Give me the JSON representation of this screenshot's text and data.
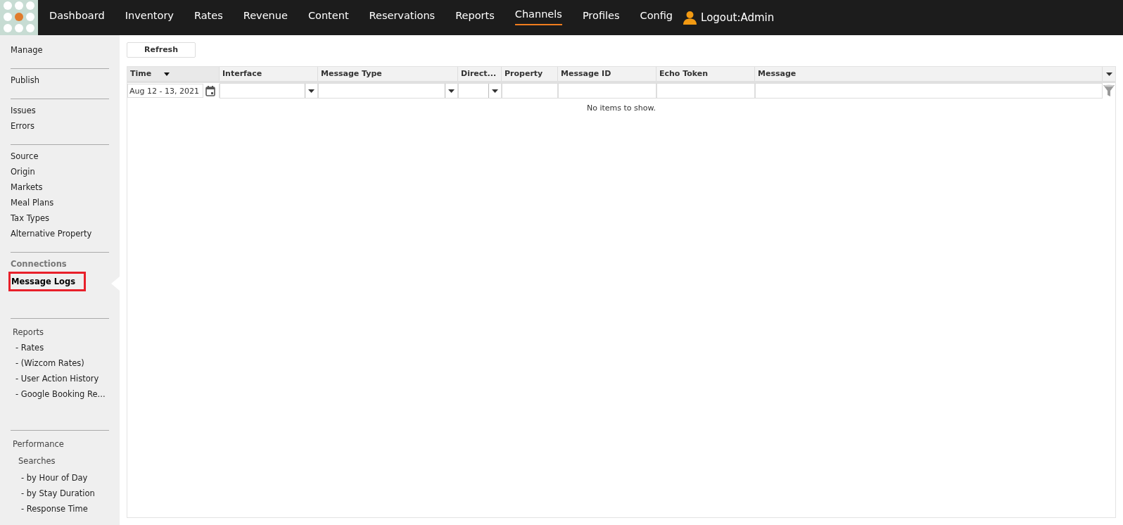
{
  "nav": {
    "items": [
      {
        "label": "Dashboard",
        "selected": false
      },
      {
        "label": "Inventory",
        "selected": false
      },
      {
        "label": "Rates",
        "selected": false
      },
      {
        "label": "Revenue",
        "selected": false
      },
      {
        "label": "Content",
        "selected": false
      },
      {
        "label": "Reservations",
        "selected": false
      },
      {
        "label": "Reports",
        "selected": false
      },
      {
        "label": "Channels",
        "selected": true
      },
      {
        "label": "Profiles",
        "selected": false
      },
      {
        "label": "Config",
        "selected": false
      }
    ],
    "user": "Logout:Admin"
  },
  "sidebar": {
    "groups": [
      {
        "items": [
          {
            "label": "Manage",
            "kind": "item",
            "selected": false
          }
        ]
      },
      {
        "items": [
          {
            "label": "Publish",
            "kind": "item",
            "selected": false
          }
        ]
      },
      {
        "items": [
          {
            "label": "Issues",
            "kind": "item",
            "selected": false
          },
          {
            "label": "Errors",
            "kind": "item",
            "selected": false
          }
        ]
      },
      {
        "items": [
          {
            "label": "Source",
            "kind": "item",
            "selected": false
          },
          {
            "label": "Origin",
            "kind": "item",
            "selected": false
          },
          {
            "label": "Markets",
            "kind": "item",
            "selected": false
          },
          {
            "label": "Meal Plans",
            "kind": "item",
            "selected": false
          },
          {
            "label": "Tax Types",
            "kind": "item",
            "selected": false
          },
          {
            "label": "Alternative Property",
            "kind": "item",
            "selected": false
          }
        ]
      },
      {
        "items": [
          {
            "label": "Connections",
            "kind": "heading",
            "selected": false
          },
          {
            "label": "Message Logs",
            "kind": "item",
            "selected": true
          }
        ]
      },
      {
        "items": [
          {
            "label": "Reports",
            "kind": "title",
            "selected": false
          },
          {
            "label": "- Rates",
            "kind": "child",
            "selected": false
          },
          {
            "label": "- (Wizcom Rates)",
            "kind": "child",
            "selected": false
          },
          {
            "label": "- User Action History",
            "kind": "child",
            "selected": false
          },
          {
            "label": "- Google Booking Re...",
            "kind": "child",
            "selected": false
          }
        ]
      },
      {
        "items": [
          {
            "label": "Performance",
            "kind": "title",
            "selected": false
          },
          {
            "label": "Searches",
            "kind": "subtitle",
            "selected": false
          },
          {
            "label": "- by Hour of Day",
            "kind": "grandchild",
            "selected": false
          },
          {
            "label": "- by Stay Duration",
            "kind": "grandchild",
            "selected": false
          },
          {
            "label": "- Response Time",
            "kind": "grandchild",
            "selected": false
          }
        ]
      }
    ]
  },
  "toolbar": {
    "refresh": "Refresh"
  },
  "table": {
    "columns": [
      {
        "label": "Time",
        "sorted": true,
        "filter": {
          "kind": "date",
          "value": "Aug 12 - 13, 2021"
        }
      },
      {
        "label": "Interface",
        "sorted": false,
        "filter": {
          "kind": "select"
        }
      },
      {
        "label": "Message Type",
        "sorted": false,
        "filter": {
          "kind": "select"
        }
      },
      {
        "label": "Direct...",
        "sorted": false,
        "filter": {
          "kind": "select"
        }
      },
      {
        "label": "Property",
        "sorted": false,
        "filter": {
          "kind": "text"
        }
      },
      {
        "label": "Message ID",
        "sorted": false,
        "filter": {
          "kind": "text"
        }
      },
      {
        "label": "Echo Token",
        "sorted": false,
        "filter": {
          "kind": "text"
        }
      },
      {
        "label": "Message",
        "sorted": false,
        "filter": {
          "kind": "text"
        }
      }
    ],
    "empty": "No items to show."
  }
}
